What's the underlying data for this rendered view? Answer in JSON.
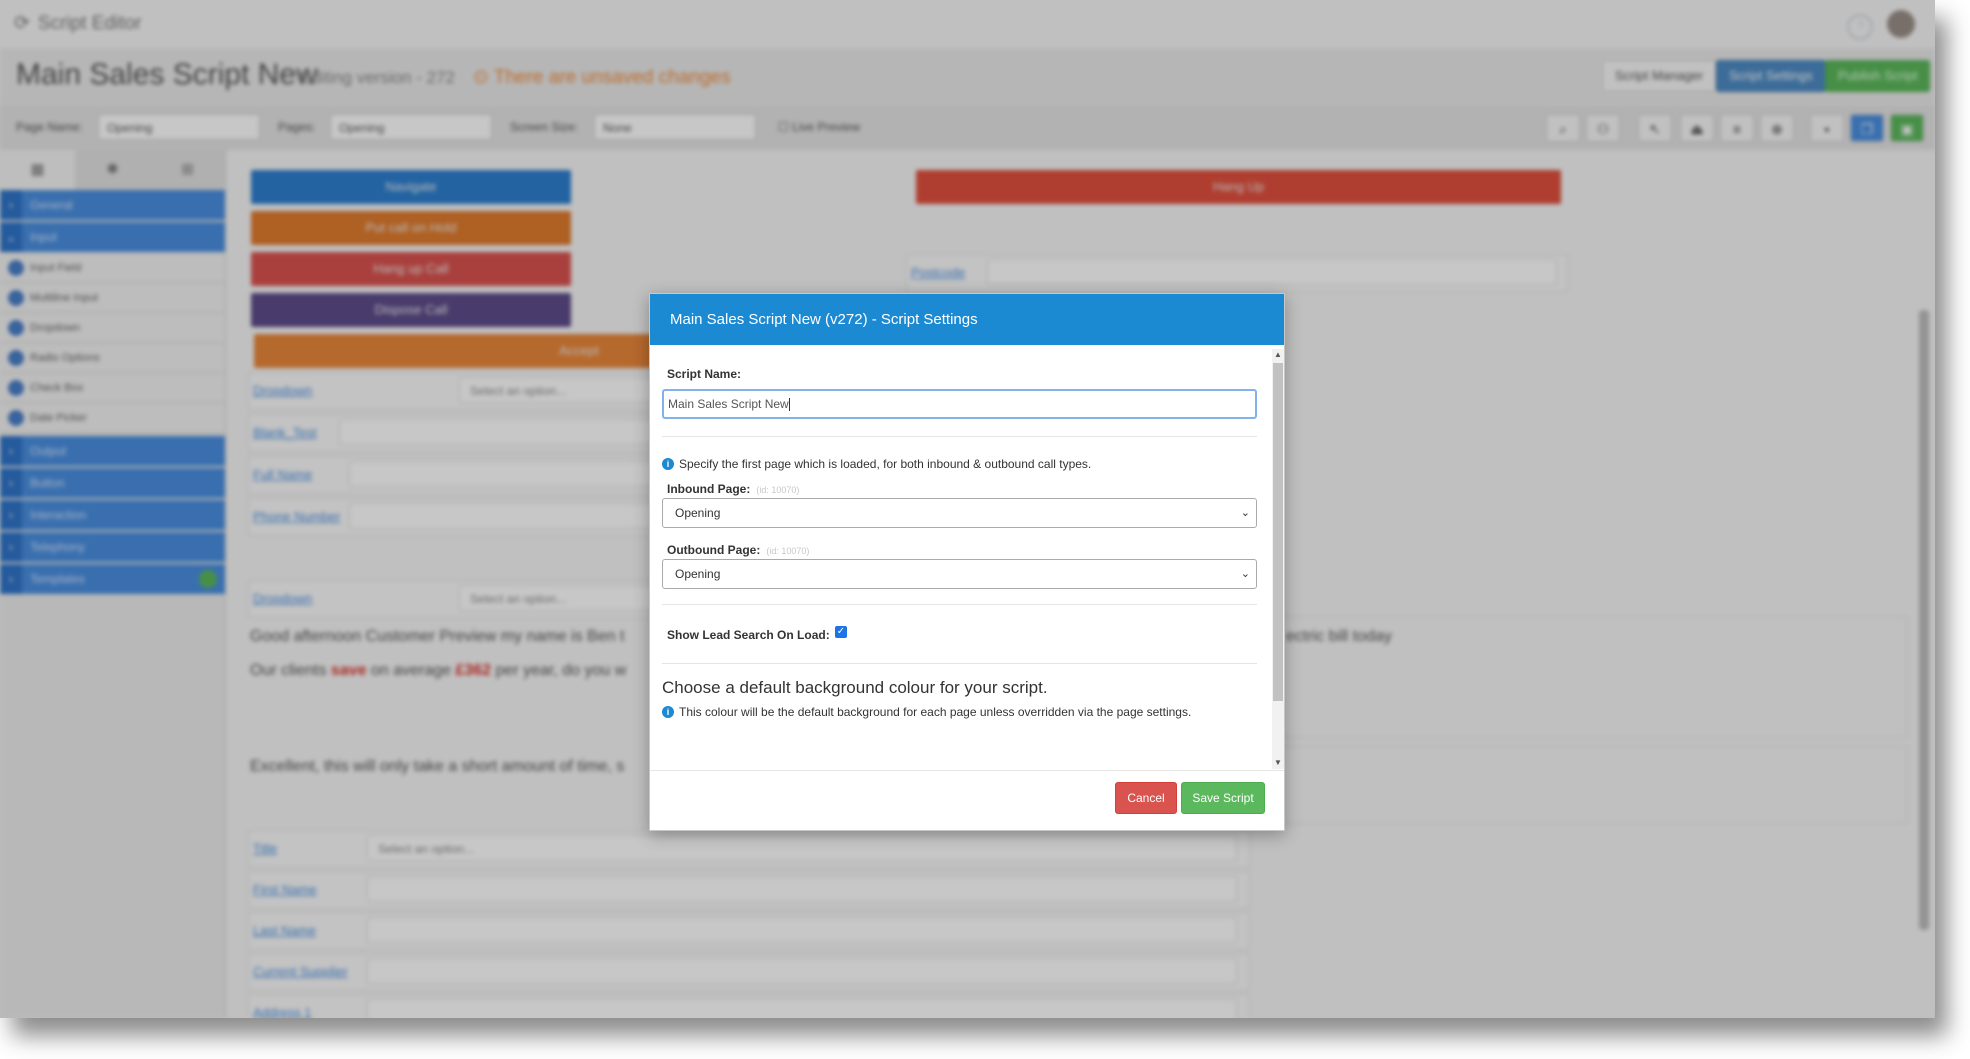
{
  "app": {
    "name": "Script Editor"
  },
  "header": {
    "title": "Main Sales Script New",
    "version": "Editing version - 272",
    "unsaved": "There are unsaved changes",
    "btn_manager": "Script Manager",
    "btn_settings": "Script Settings",
    "btn_publish": "Publish Script"
  },
  "toolbar": {
    "page_name_label": "Page Name:",
    "page_name_value": "Opening",
    "pages_label": "Pages:",
    "pages_value": "Opening",
    "screen_size_label": "Screen Size:",
    "screen_size_value": "None",
    "live_preview": "Live Preview"
  },
  "sidebar": {
    "groups": [
      "General",
      "Input",
      "Output",
      "Button",
      "Interaction",
      "Telephony",
      "Templates"
    ],
    "input_items": [
      "Input Field",
      "Multiline Input",
      "Dropdown",
      "Radio Options",
      "Check Box",
      "Date Picker"
    ]
  },
  "canvas": {
    "buttons": [
      "Navigate",
      "Put call on Hold",
      "Hang up Call",
      "Dispose Call",
      "Accept",
      "Hang Up"
    ],
    "fields": [
      {
        "label": "Dropdown",
        "placeholder": "Select an option..."
      },
      {
        "label": "Blank_Test",
        "placeholder": ""
      },
      {
        "label": "Full Name",
        "placeholder": ""
      },
      {
        "label": "Phone Number",
        "placeholder": ""
      },
      {
        "label": "Postcode",
        "placeholder": ""
      },
      {
        "label": "Dropdown",
        "placeholder": "Select an option..."
      },
      {
        "label": "Title",
        "placeholder": "Select an option..."
      },
      {
        "label": "First Name",
        "placeholder": ""
      },
      {
        "label": "Last Name",
        "placeholder": ""
      },
      {
        "label": "Current Supplier",
        "placeholder": ""
      },
      {
        "label": "Address 1",
        "placeholder": ""
      }
    ],
    "para1": "Good afternoon Customer Preview my name is Ben t",
    "para1_tail": "ectric bill today",
    "para2_pre": "Our clients",
    "para2_save": "save",
    "para2_mid": "on average",
    "para2_amount": "£362",
    "para2_post": "per year, do you w",
    "para3": "Excellent, this will only take a short amount of time, s"
  },
  "modal": {
    "title": "Main Sales Script New (v272) - Script Settings",
    "script_name_label": "Script Name:",
    "script_name_value": "Main Sales Script New",
    "info_first_page": "Specify the first page which is loaded, for both inbound & outbound call types.",
    "inbound_label": "Inbound Page:",
    "inbound_hint": "(id: 10070)",
    "inbound_value": "Opening",
    "outbound_label": "Outbound Page:",
    "outbound_hint": "(id: 10070)",
    "outbound_value": "Opening",
    "lead_search_label": "Show Lead Search On Load:",
    "lead_search_checked": true,
    "bg_heading": "Choose a default background colour for your script.",
    "bg_info": "This colour will be the default background for each page unless overridden via the page settings.",
    "cancel": "Cancel",
    "save": "Save Script"
  },
  "colors": {
    "modal_header": "#1b8ad3",
    "save_button": "#5cb85c",
    "cancel_button": "#d9534f",
    "script_settings_button": "#4e8bc4",
    "unsaved_text": "#f08a3a",
    "sidebar_group": "#4a8fe0"
  }
}
